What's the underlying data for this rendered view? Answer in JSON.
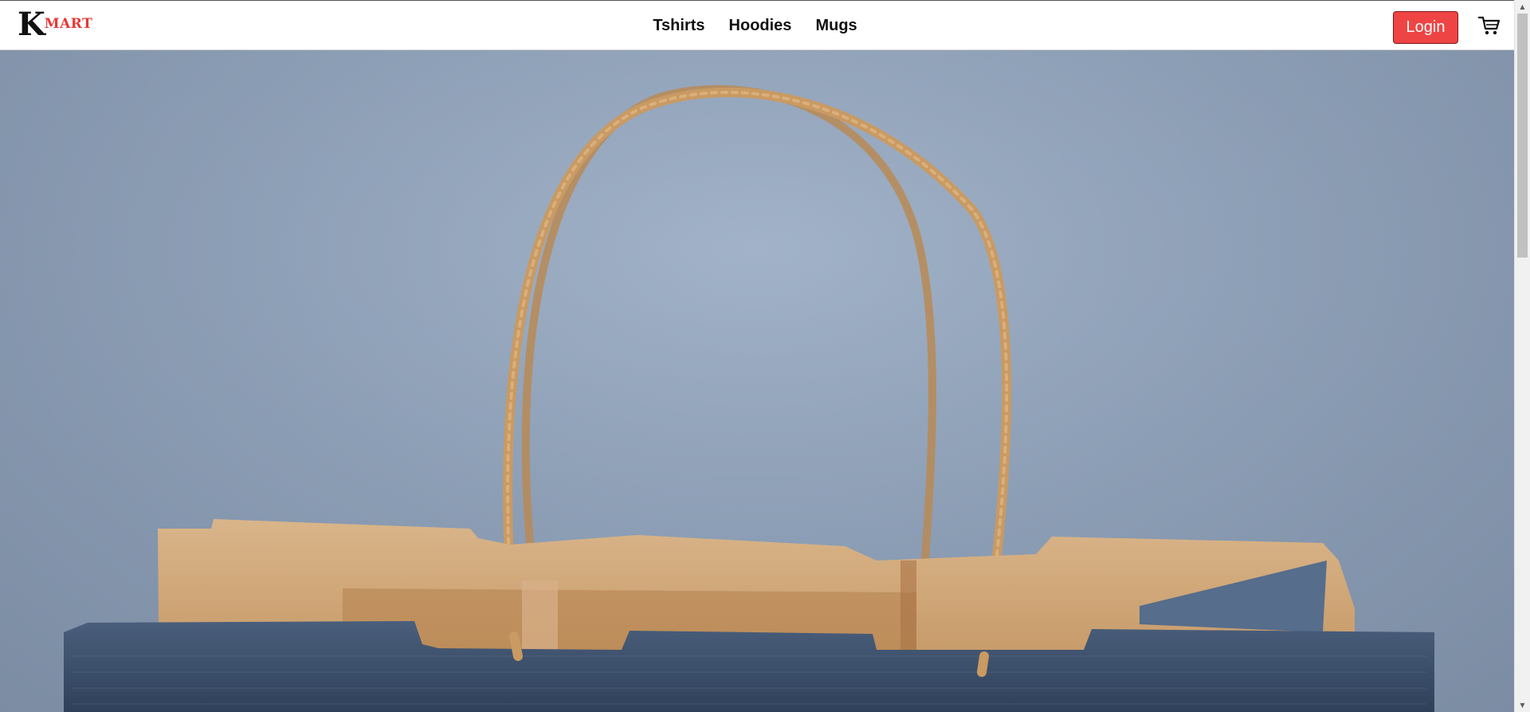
{
  "brand": {
    "logo_initial": "K",
    "logo_rest": "MART",
    "accent_color": "#ef4444"
  },
  "nav": {
    "links": [
      {
        "label": "Tshirts"
      },
      {
        "label": "Hoodies"
      },
      {
        "label": "Mugs"
      }
    ],
    "login_label": "Login",
    "cart_icon": "shopping-cart-icon"
  },
  "hero": {
    "image_subject": "paper-shopping-bag-photo"
  },
  "scrollbar": {
    "up_icon": "scroll-up-arrow-icon",
    "down_icon": "scroll-down-arrow-icon"
  }
}
